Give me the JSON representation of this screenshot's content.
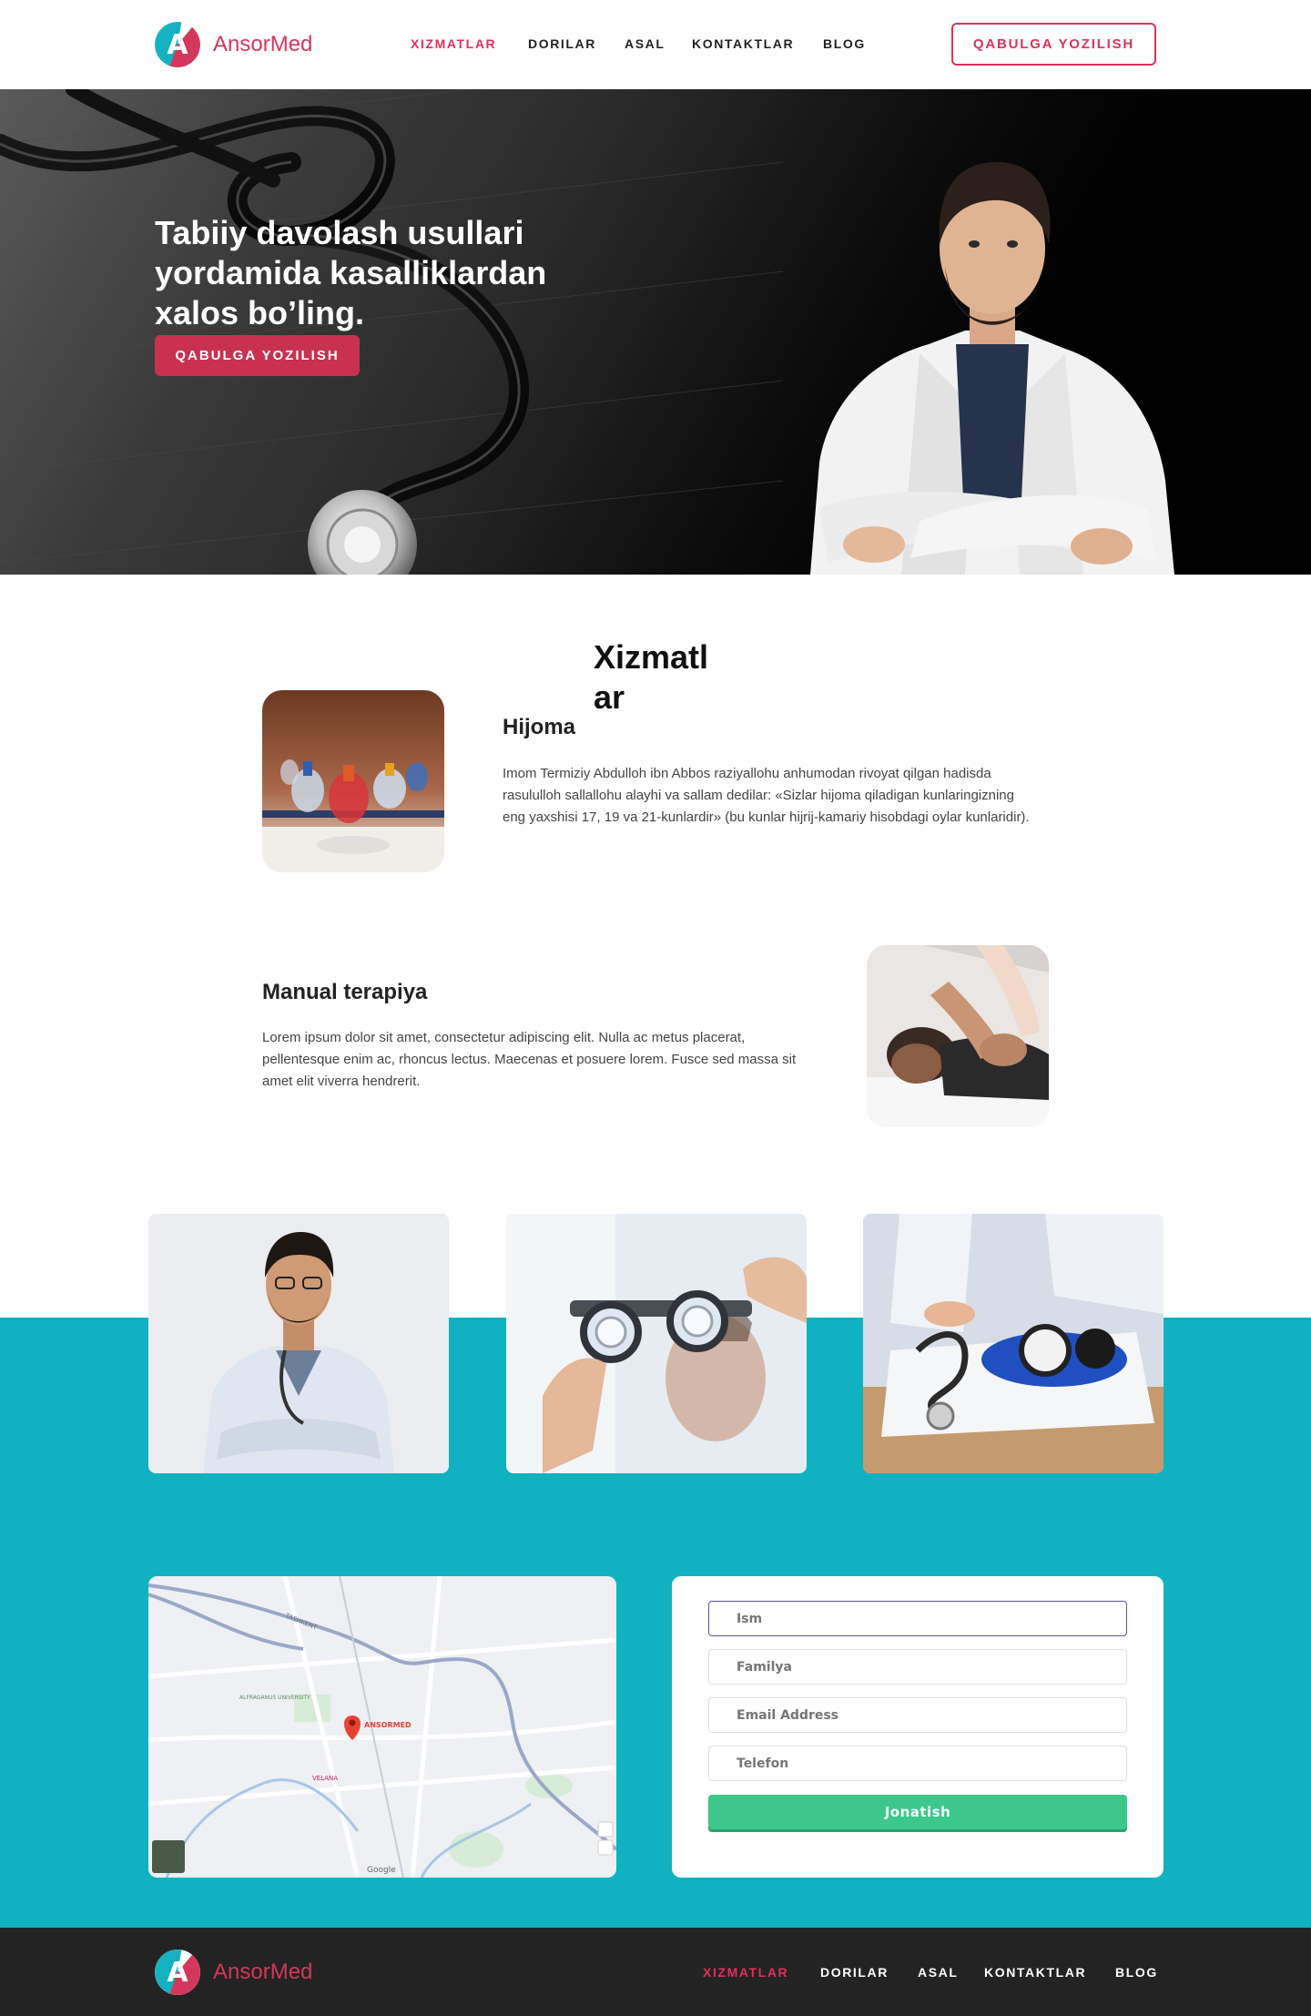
{
  "brand": {
    "name": "AnsorMed",
    "logo_letter": "A"
  },
  "nav": {
    "items": [
      {
        "label": "XIZMATLAR",
        "active": true
      },
      {
        "label": "DORILAR",
        "active": false
      },
      {
        "label": "ASAL",
        "active": false
      },
      {
        "label": "KONTAKTLAR",
        "active": false
      },
      {
        "label": "BLOG",
        "active": false
      }
    ],
    "cta": "QABULGA YOZILISH"
  },
  "hero": {
    "title": "Tabiiy davolash usullari yordamida kasalliklardan xalos bo’ling.",
    "cta": "QABULGA YOZILISH"
  },
  "services": {
    "title": "Xizmatlar",
    "items": [
      {
        "name": "Hijoma",
        "description": "Imom Termiziy Abdulloh ibn Abbos raziyallohu anhumodan rivoyat qilgan hadisda rasululloh sallallohu alayhi va sallam dedilar: «Sizlar hijoma qiladigan kunlaringizning eng yaxshisi 17, 19 va 21-kunlardir» (bu kunlar hijrij-kamariy hisobdagi oylar kunlaridir)."
      },
      {
        "name": "Manual terapiya",
        "description": "Lorem ipsum dolor sit amet, consectetur adipiscing elit. Nulla ac metus placerat, pellentesque enim ac, rhoncus lectus. Maecenas et posuere lorem. Fusce sed massa sit amet elit viverra hendrerit."
      }
    ]
  },
  "form": {
    "fields": [
      {
        "placeholder": "Ism"
      },
      {
        "placeholder": "Familya"
      },
      {
        "placeholder": "Email Address"
      },
      {
        "placeholder": "Telefon"
      }
    ],
    "submit": "Jonatish"
  },
  "map": {
    "labels": [
      "ANSORMED",
      "TASHKENT",
      "VELANA",
      "ALFRAGANUS UNIVERSITY",
      "Google"
    ]
  },
  "footer": {
    "nav": [
      "XIZMATLAR",
      "DORILAR",
      "ASAL",
      "KONTAKTLAR",
      "BLOG"
    ]
  },
  "colors": {
    "brand_red": "#d3375a",
    "brand_teal": "#10b2c1",
    "submit_green": "#3cc88a",
    "footer_bg": "#232323"
  }
}
